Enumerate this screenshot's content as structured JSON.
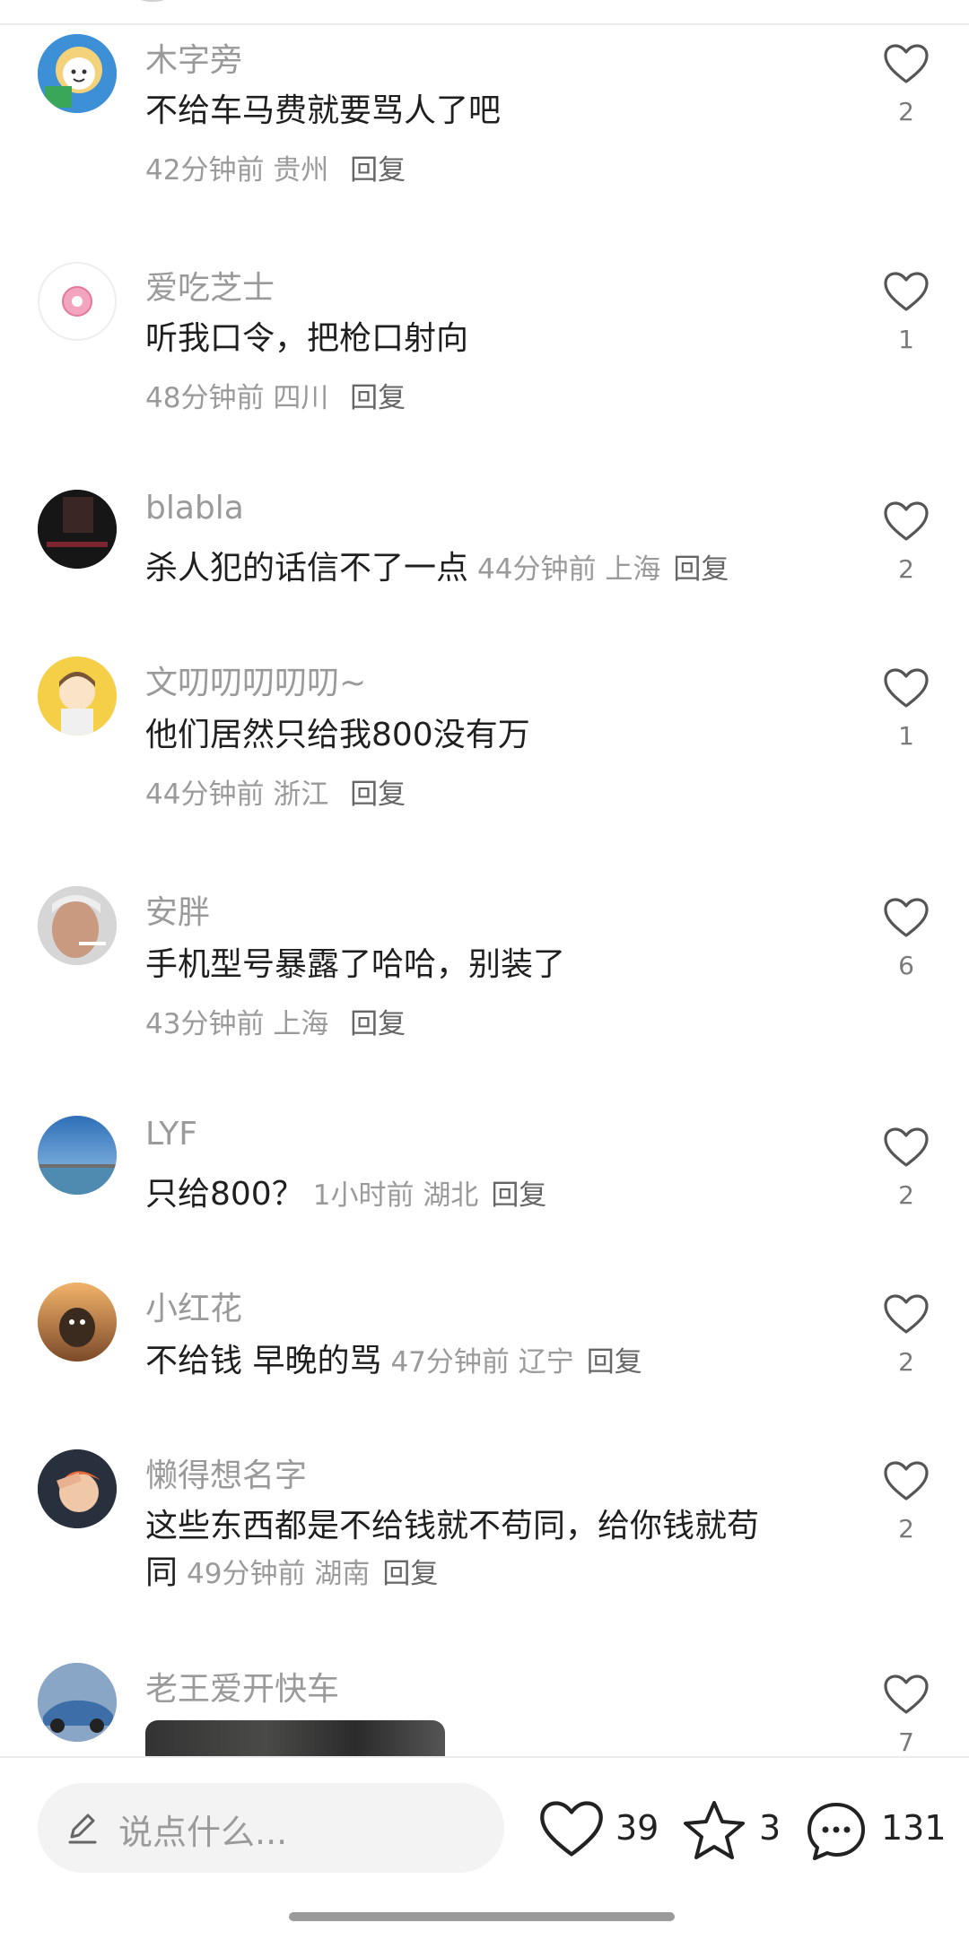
{
  "comments": [
    {
      "username": "木字旁",
      "text": "不给车马费就要骂人了吧",
      "time": "42分钟前",
      "location": "贵州",
      "reply": "回复",
      "likes": "2"
    },
    {
      "username": "爱吃芝士",
      "text": "听我口令，把枪口射向",
      "time": "48分钟前",
      "location": "四川",
      "reply": "回复",
      "likes": "1"
    },
    {
      "username": "blabla",
      "text": "杀人犯的话信不了一点",
      "time": "44分钟前",
      "location": "上海",
      "reply": "回复",
      "likes": "2"
    },
    {
      "username": "文叨叨叨叨叨~",
      "text": "他们居然只给我800没有万",
      "time": "44分钟前",
      "location": "浙江",
      "reply": "回复",
      "likes": "1"
    },
    {
      "username": "安胖",
      "text": "手机型号暴露了哈哈，别装了",
      "time": "43分钟前",
      "location": "上海",
      "reply": "回复",
      "likes": "6"
    },
    {
      "username": "LYF",
      "text": "只给800？",
      "time": "1小时前",
      "location": "湖北",
      "reply": "回复",
      "likes": "2"
    },
    {
      "username": "小红花",
      "text": "不给钱 早晚的骂",
      "time": "47分钟前",
      "location": "辽宁",
      "reply": "回复",
      "likes": "2"
    },
    {
      "username": "懒得想名字",
      "text_line1": "这些东西都是不给钱就不苟同，给你钱就苟",
      "text_line2": "同",
      "time": "49分钟前",
      "location": "湖南",
      "reply": "回复",
      "likes": "2"
    },
    {
      "username": "老王爱开快车",
      "likes": "7"
    }
  ],
  "bottom_bar": {
    "input_placeholder": "说点什么...",
    "like_count": "39",
    "star_count": "3",
    "comment_count": "131"
  },
  "icons": {
    "edit": "pencil-icon",
    "like": "heart-outline-icon",
    "favorite": "star-outline-icon",
    "comment": "chat-bubble-icon"
  },
  "colors": {
    "secondary_text": "#9a9a9a",
    "primary_text": "#1f1f1f",
    "input_bg": "#f3f3f3"
  }
}
